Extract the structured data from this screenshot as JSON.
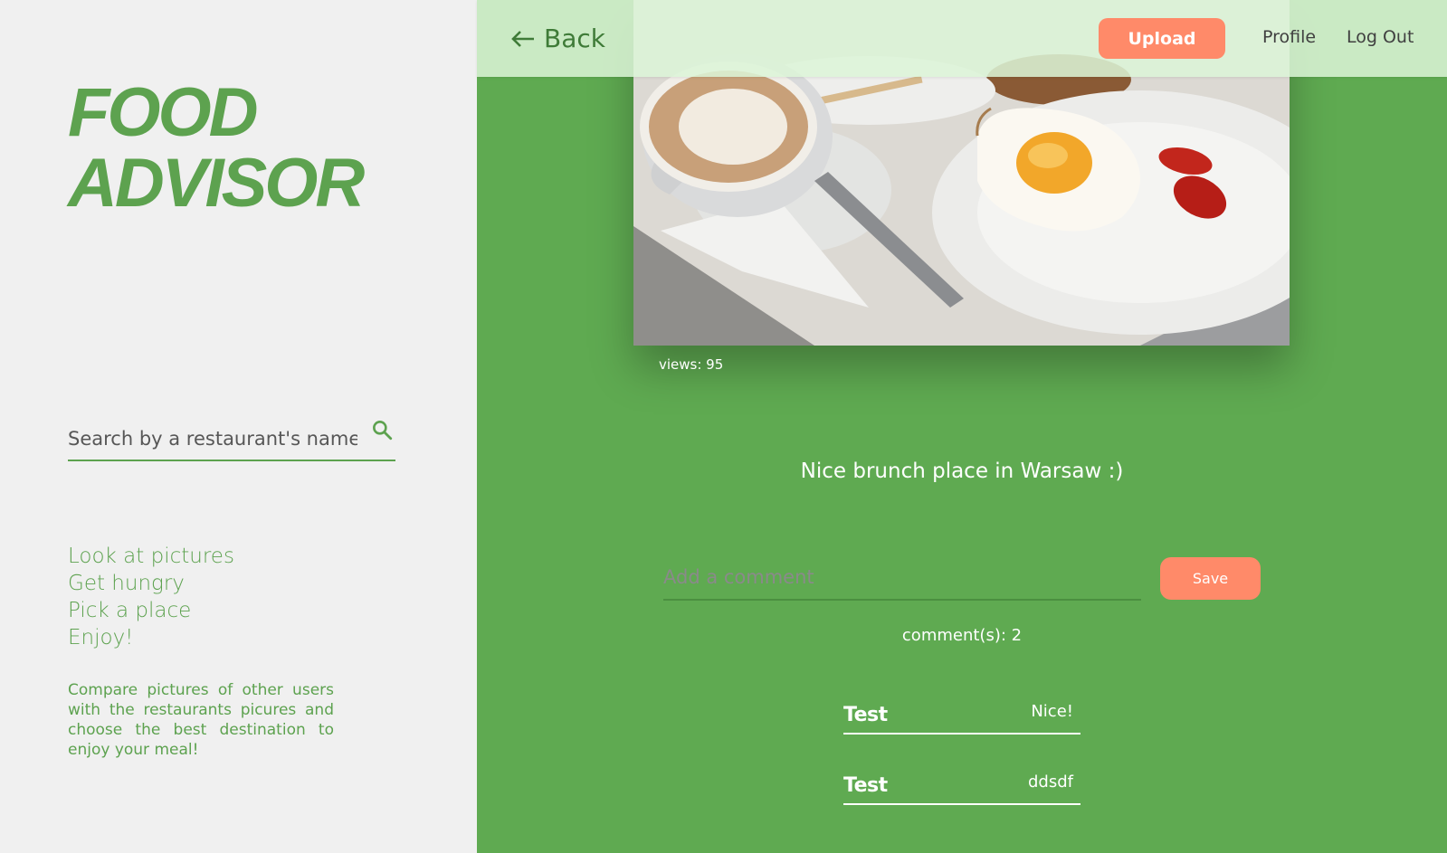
{
  "sidebar": {
    "logo_line1": "FOOD",
    "logo_line2": "ADVISOR",
    "search_placeholder": "Search by a restaurant's name",
    "search_icon": "search-icon",
    "steps": [
      "Look at pictures",
      "Get hungry",
      "Pick a place",
      "Enjoy!"
    ],
    "description": "Compare pictures of other users with the restaurants picures and choose the best destination to enjoy your meal!"
  },
  "header": {
    "back_label": "Back",
    "back_icon": "arrow-left-icon",
    "upload_label": "Upload",
    "profile_label": "Profile",
    "logout_label": "Log Out"
  },
  "post": {
    "views": "views: 95",
    "caption": "Nice brunch place in Warsaw :)",
    "comment_placeholder": "Add a comment",
    "save_label": "Save",
    "comment_count": "comment(s): 2",
    "comments": [
      {
        "user": "Test",
        "text": "Nice!"
      },
      {
        "user": "Test",
        "text": "ddsdf"
      }
    ]
  },
  "colors": {
    "brand_green": "#5da24f",
    "main_green": "#5faa51",
    "accent_orange": "#ff8a69",
    "topbar": "#dcf4d7"
  }
}
